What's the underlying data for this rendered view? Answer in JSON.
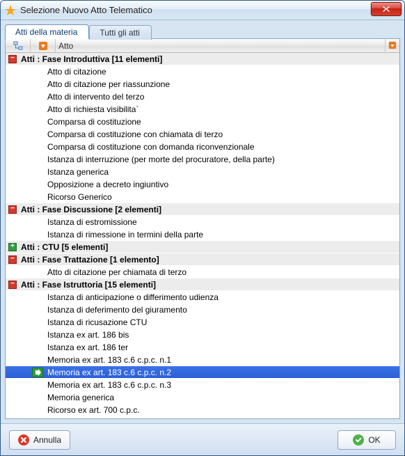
{
  "window": {
    "title": "Selezione Nuovo Atto Telematico"
  },
  "tabs": [
    {
      "label": "Atti della materia",
      "active": true
    },
    {
      "label": "Tutti gli atti",
      "active": false
    }
  ],
  "grid": {
    "header": {
      "col3": "Atto"
    },
    "groups": [
      {
        "title": "Atti : Fase Introduttiva  [11 elementi]",
        "state": "minus",
        "items": [
          "Atto di citazione",
          "Atto di citazione per riassunzione",
          "Atto di intervento del terzo",
          "Atto di richiesta visibilita`",
          "Comparsa di costituzione",
          "Comparsa di costituzione con chiamata di terzo",
          "Comparsa di costituzione con domanda riconvenzionale",
          "Istanza di interruzione (per morte del procuratore, della parte)",
          "Istanza generica",
          "Opposizione a decreto ingiuntivo",
          "Ricorso Generico"
        ]
      },
      {
        "title": "Atti : Fase Discussione  [2 elementi]",
        "state": "minus",
        "items": [
          "Istanza di estromissione",
          "Istanza di rimessione in termini della parte"
        ]
      },
      {
        "title": "Atti : CTU  [5 elementi]",
        "state": "plus",
        "items": []
      },
      {
        "title": "Atti : Fase Trattazione  [1 elemento]",
        "state": "minus",
        "items": [
          "Atto di citazione per chiamata di terzo"
        ]
      },
      {
        "title": "Atti : Fase Istruttoria  [15 elementi]",
        "state": "minus",
        "items": [
          "Istanza di anticipazione o differimento udienza",
          "Istanza di deferimento del giuramento",
          "Istanza di ricusazione CTU",
          "Istanza ex art. 186 bis",
          "Istanza ex art. 186 ter",
          "Memoria ex art. 183 c.6 c.p.c. n.1",
          "Memoria ex art. 183 c.6 c.p.c. n.2",
          "Memoria ex art. 183 c.6 c.p.c. n.3",
          "Memoria generica",
          "Ricorso ex art. 700 c.p.c."
        ]
      }
    ],
    "selected": {
      "group": 4,
      "item": 6
    }
  },
  "footer": {
    "cancel": "Annulla",
    "ok": "OK"
  }
}
